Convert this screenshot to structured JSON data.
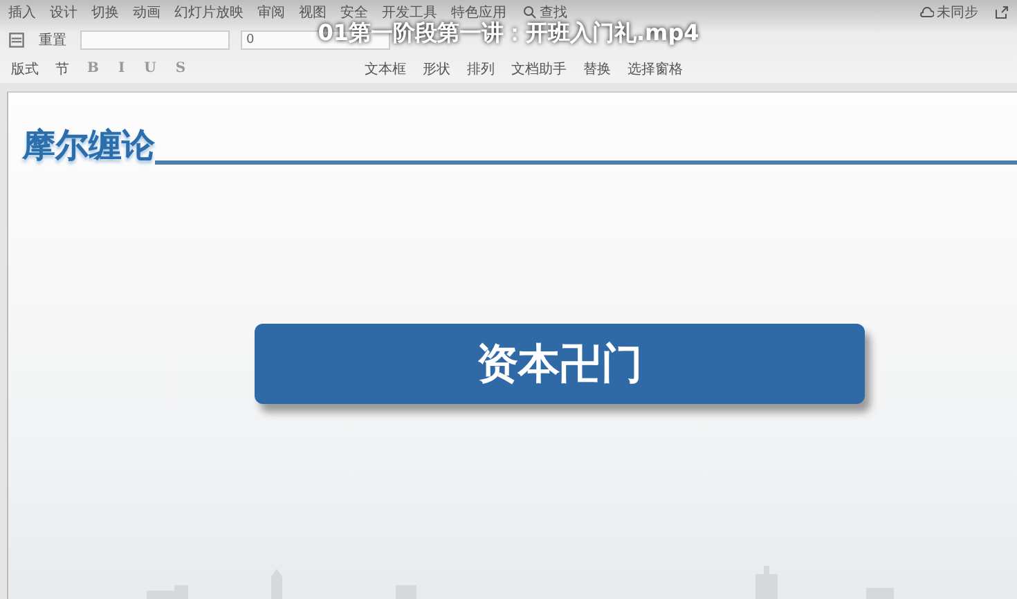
{
  "video_title": "01第一阶段第一讲：开班入门礼.mp4",
  "menu": [
    {
      "label": "插入",
      "selected": false
    },
    {
      "label": "设计",
      "selected": false
    },
    {
      "label": "切换",
      "selected": false
    },
    {
      "label": "动画",
      "selected": false
    },
    {
      "label": "幻灯片放映",
      "selected": false
    },
    {
      "label": "审阅",
      "selected": false
    },
    {
      "label": "视图",
      "selected": false
    },
    {
      "label": "安全",
      "selected": false
    },
    {
      "label": "开发工具",
      "selected": false
    },
    {
      "label": "特色应用",
      "selected": false
    }
  ],
  "search": "查找",
  "sync": "未同步",
  "toolbar_left": [
    {
      "label": "版式"
    },
    {
      "label": "节"
    }
  ],
  "reset": "重置",
  "font_size": "0",
  "format_buttons": [
    "B",
    "I",
    "U",
    "S"
  ],
  "toolbar_right": [
    {
      "label": "文本框"
    },
    {
      "label": "形状"
    },
    {
      "label": "排列"
    },
    {
      "label": "文档助手"
    },
    {
      "label": "替换"
    },
    {
      "label": "选择窗格"
    }
  ],
  "slide": {
    "heading": "摩尔缠论",
    "banner": "资本卍门"
  }
}
